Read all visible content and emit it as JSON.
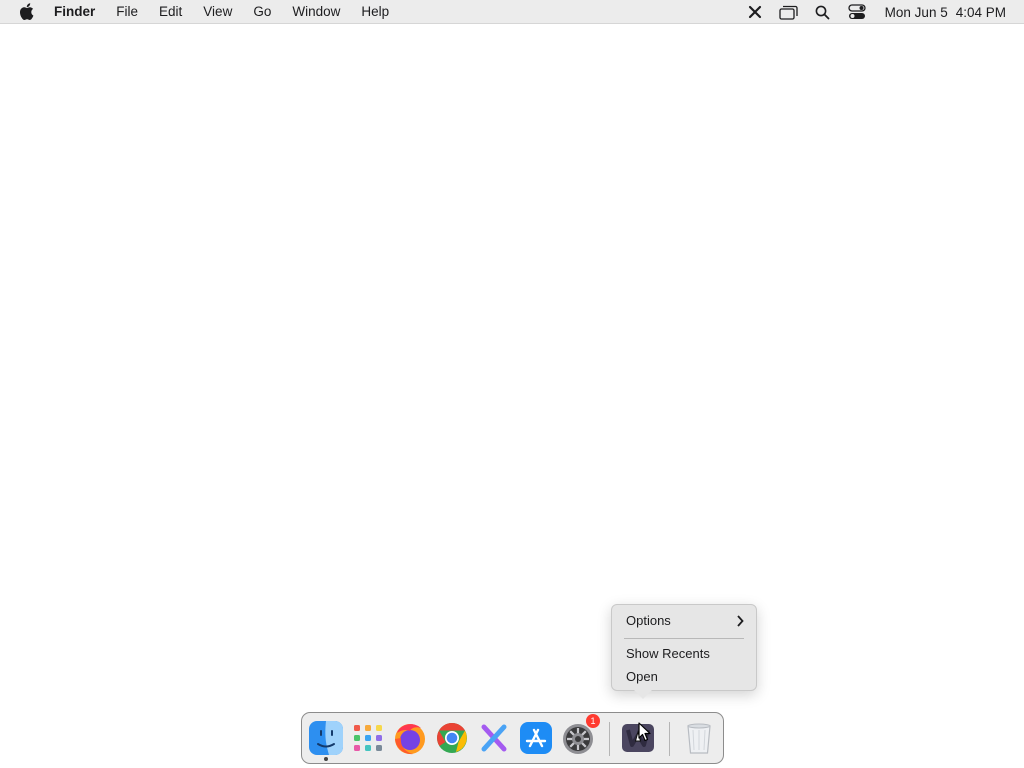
{
  "menubar": {
    "app_name": "Finder",
    "items": [
      "File",
      "Edit",
      "View",
      "Go",
      "Window",
      "Help"
    ],
    "status_icons": [
      "close-x-icon",
      "screen-mirroring-icon",
      "spotlight-search-icon",
      "control-center-icon"
    ],
    "date": "Mon Jun 5",
    "time": "4:04 PM"
  },
  "context_menu": {
    "options_label": "Options",
    "show_recents_label": "Show Recents",
    "open_label": "Open"
  },
  "dock": {
    "apps": [
      "finder",
      "launchpad",
      "firefox",
      "chrome",
      "x-app",
      "app-store",
      "system-settings",
      "app-with-menu"
    ],
    "system_settings_badge": "1"
  }
}
